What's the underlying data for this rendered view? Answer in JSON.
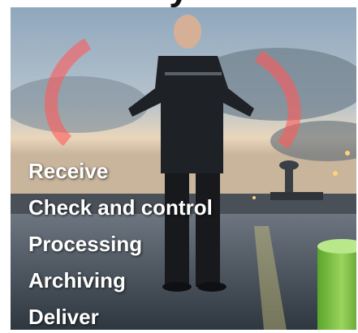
{
  "heading_fragment": "y",
  "steps": [
    "Receive",
    "Check and control",
    "Processing",
    "Archiving",
    "Deliver"
  ],
  "colors": {
    "sky_top": "#9fb6c9",
    "sky_bottom": "#f0d8b8",
    "light_trail": "#ff5050",
    "tarmac": "#3e4a55",
    "cylinder_green": "#7cc242",
    "text": "#ffffff"
  }
}
